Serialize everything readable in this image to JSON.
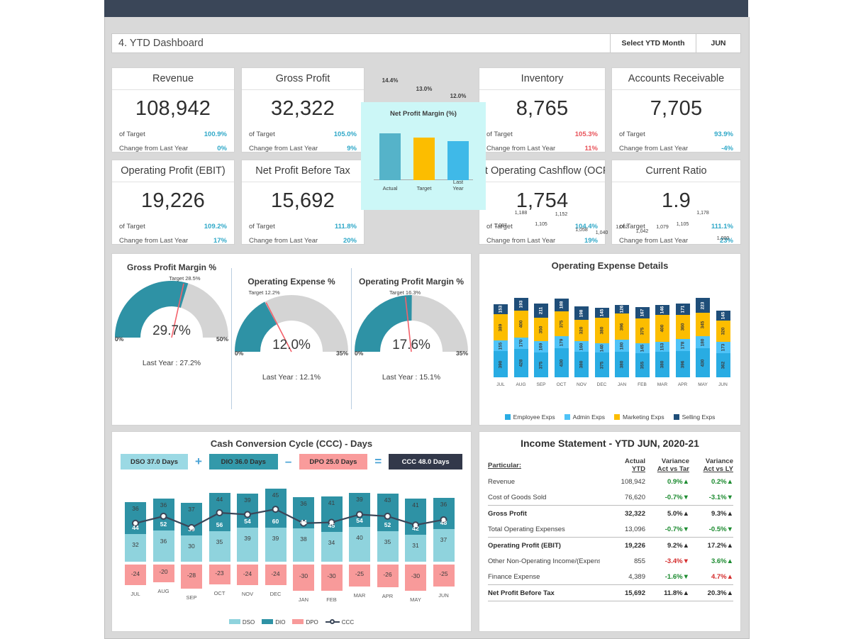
{
  "header": {
    "title": "4. YTD Dashboard",
    "select_label": "Select YTD Month",
    "select_value": "JUN"
  },
  "kpis": [
    {
      "title": "Revenue",
      "value": "108,942",
      "target_label": "of Target",
      "target_value": "100.9%",
      "target_tone": "pos",
      "ly_label": "Change from Last Year",
      "ly_value": "0%",
      "ly_tone": "pos"
    },
    {
      "title": "Gross Profit",
      "value": "32,322",
      "target_label": "of Target",
      "target_value": "105.0%",
      "target_tone": "pos",
      "ly_label": "Change from Last Year",
      "ly_value": "9%",
      "ly_tone": "pos"
    },
    {
      "title": "Inventory",
      "value": "8,765",
      "target_label": "of Target",
      "target_value": "105.3%",
      "target_tone": "neg",
      "ly_label": "Change from Last Year",
      "ly_value": "11%",
      "ly_tone": "neg"
    },
    {
      "title": "Accounts Receivable",
      "value": "7,705",
      "target_label": "of Target",
      "target_value": "93.9%",
      "target_tone": "pos",
      "ly_label": "Change from Last Year",
      "ly_value": "-4%",
      "ly_tone": "pos"
    },
    {
      "title": "Operating Profit (EBIT)",
      "value": "19,226",
      "target_label": "of Target",
      "target_value": "109.2%",
      "target_tone": "pos",
      "ly_label": "Change from Last Year",
      "ly_value": "17%",
      "ly_tone": "pos"
    },
    {
      "title": "Net Profit Before Tax",
      "value": "15,692",
      "target_label": "of Target",
      "target_value": "111.8%",
      "target_tone": "pos",
      "ly_label": "Change from Last Year",
      "ly_value": "20%",
      "ly_tone": "pos"
    },
    {
      "title": "Net Operating Cashflow (OCF)",
      "value": "1,754",
      "target_label": "of Target",
      "target_value": "104.4%",
      "target_tone": "pos",
      "ly_label": "Change from Last Year",
      "ly_value": "19%",
      "ly_tone": "pos"
    },
    {
      "title": "Current Ratio",
      "value": "1.9",
      "target_label": "of Target",
      "target_value": "111.1%",
      "target_tone": "pos",
      "ly_label": "Change from Last Year",
      "ly_value": "23%",
      "ly_tone": "pos"
    }
  ],
  "gauges_panel_title": "",
  "gauges": [
    {
      "title": "Gross Profit Margin %",
      "value": "29.7%",
      "value_num": 29.7,
      "min": "0%",
      "max": "50%",
      "min_num": 0,
      "max_num": 50,
      "target_label": "Target 28.5%",
      "target_num": 28.5,
      "last_year": "Last Year : 27.2%"
    },
    {
      "title": "Operating Expense %",
      "value": "12.0%",
      "value_num": 12.0,
      "min": "0%",
      "max": "35%",
      "min_num": 0,
      "max_num": 35,
      "target_label": "Target 12.2%",
      "target_num": 12.2,
      "last_year": "Last Year : 12.1%"
    },
    {
      "title": "Operating Profit Margin %",
      "value": "17.6%",
      "value_num": 17.6,
      "min": "0%",
      "max": "35%",
      "min_num": 0,
      "max_num": 35,
      "target_label": "Target 16.3%",
      "target_num": 16.3,
      "last_year": "Last Year : 15.1%"
    }
  ],
  "income_statement": {
    "title": "Income Statement - YTD JUN, 2020-21",
    "columns": [
      "Particular:",
      "Actual\nYTD",
      "Variance\nAct vs Tar",
      "Variance\nAct vs LY"
    ],
    "col_particulars": "Particular:",
    "col_actual_1": "Actual",
    "col_actual_2": "YTD",
    "col_var_tar_1": "Variance",
    "col_var_tar_2": "Act vs Tar",
    "col_var_ly_1": "Variance",
    "col_var_ly_2": "Act vs LY",
    "rows": [
      {
        "label": "Revenue",
        "actual": "108,942",
        "var_tar": "0.9%▲",
        "var_tar_tone": "up",
        "var_ly": "0.2%▲",
        "var_ly_tone": "up",
        "bold": false
      },
      {
        "label": "Cost of Goods Sold",
        "actual": "76,620",
        "var_tar": "-0.7%▼",
        "var_tar_tone": "up",
        "var_ly": "-3.1%▼",
        "var_ly_tone": "up",
        "bold": false
      },
      {
        "label": "Gross Profit",
        "actual": "32,322",
        "var_tar": "5.0%▲",
        "var_tar_tone": "up",
        "var_ly": "9.3%▲",
        "var_ly_tone": "up",
        "bold": true
      },
      {
        "label": "Total Operating Expenses",
        "actual": "13,096",
        "var_tar": "-0.7%▼",
        "var_tar_tone": "up",
        "var_ly": "-0.5%▼",
        "var_ly_tone": "up",
        "bold": false
      },
      {
        "label": "Operating Profit (EBIT)",
        "actual": "19,226",
        "var_tar": "9.2%▲",
        "var_tar_tone": "up",
        "var_ly": "17.2%▲",
        "var_ly_tone": "up",
        "bold": true
      },
      {
        "label": "Other Non-Operating Income/(Expens",
        "actual": "855",
        "var_tar": "-3.4%▼",
        "var_tar_tone": "bad",
        "var_ly": "3.6%▲",
        "var_ly_tone": "up",
        "bold": false
      },
      {
        "label": "Finance Expense",
        "actual": "4,389",
        "var_tar": "-1.6%▼",
        "var_tar_tone": "up",
        "var_ly": "4.7%▲",
        "var_ly_tone": "bad",
        "bold": false
      },
      {
        "label": "Net Profit Before Tax",
        "actual": "15,692",
        "var_tar": "11.8%▲",
        "var_tar_tone": "up",
        "var_ly": "20.3%▲",
        "var_ly_tone": "up",
        "bold": true
      }
    ]
  },
  "ccc": {
    "title": "Cash Conversion Cycle (CCC) - Days",
    "chips": [
      {
        "text": "DSO 37.0 Days",
        "bg": "#9bd9e4"
      },
      {
        "text": "DIO 36.0 Days",
        "bg": "#3399aa"
      },
      {
        "text": "DPO 25.0 Days",
        "bg": "#f99b9b"
      },
      {
        "text": "CCC 48.0 Days",
        "bg": "#32384a"
      }
    ],
    "ops": [
      "+",
      "–",
      "="
    ],
    "legend": [
      "DSO",
      "DIO",
      "DPO",
      "CCC"
    ]
  },
  "colors": {
    "teal": "#3e9fb5",
    "dark_blue": "#1f5f9e",
    "light_blue": "#29ace3",
    "amber": "#fcbd00",
    "navy": "#1f4e79",
    "dso": "#8fd3dd",
    "dio": "#2e92a5",
    "dpo": "#f89a9a",
    "ccc_line": "#3a4658",
    "topbar": "#3a4658",
    "npm_bg": "#ccf7f7"
  },
  "chart_data": [
    {
      "type": "bar",
      "title": "Net Profit Margin (%)",
      "categories": [
        "Actual",
        "Target",
        "Last Year"
      ],
      "values": [
        14.4,
        13.0,
        12.0
      ],
      "labels": [
        "14.4%",
        "13.0%",
        "12.0%"
      ],
      "colors": [
        "#55b3c9",
        "#fcbd00",
        "#3fb9e8"
      ],
      "ylim": [
        0,
        17
      ],
      "grid": false,
      "legend": "none"
    },
    {
      "type": "bar",
      "title": "Operating Expense Details",
      "stacked": true,
      "categories": [
        "JUL",
        "AUG",
        "SEP",
        "OCT",
        "NOV",
        "DEC",
        "JAN",
        "FEB",
        "MAR",
        "APR",
        "MAY",
        "JUN"
      ],
      "totals": [
        1087,
        1188,
        1105,
        1152,
        1058,
        1040,
        1062,
        1042,
        1079,
        1105,
        1178,
        1000
      ],
      "total_labels": [
        "1,087",
        "1,188",
        "1,105",
        "1,152",
        "1,058",
        "1,040",
        "1,062",
        "1,042",
        "1,079",
        "1,105",
        "1,178",
        "1,000"
      ],
      "series": [
        {
          "name": "Employee Exps",
          "color": "#29ace3",
          "values": [
            390,
            428,
            375,
            430,
            380,
            375,
            380,
            355,
            380,
            396,
            430,
            362
          ]
        },
        {
          "name": "Admin Exps",
          "color": "#4fc3f7",
          "values": [
            155,
            170,
            169,
            179,
            160,
            140,
            180,
            145,
            153,
            178,
            180,
            173
          ]
        },
        {
          "name": "Marketing Exps",
          "color": "#fcbd00",
          "values": [
            389,
            400,
            350,
            375,
            320,
            380,
            396,
            375,
            400,
            360,
            345,
            320
          ]
        },
        {
          "name": "Selling Exps",
          "color": "#1f4e79",
          "values": [
            153,
            193,
            211,
            188,
            198,
            145,
            126,
            167,
            146,
            171,
            223,
            145
          ]
        }
      ],
      "legend": "bottom",
      "ylim": [
        0,
        1250
      ]
    },
    {
      "type": "bar",
      "title": "Cash Conversion Cycle (CCC) - Days",
      "stacked": true,
      "categories": [
        "JUL",
        "AUG",
        "SEP",
        "OCT",
        "NOV",
        "DEC",
        "JAN",
        "FEB",
        "MAR",
        "APR",
        "MAY",
        "JUN"
      ],
      "series": [
        {
          "name": "DSO",
          "color": "#8fd3dd",
          "values": [
            32,
            36,
            30,
            35,
            39,
            39,
            38,
            34,
            40,
            35,
            31,
            37
          ]
        },
        {
          "name": "DIO",
          "color": "#2e92a5",
          "values": [
            36,
            36,
            37,
            44,
            39,
            45,
            36,
            41,
            39,
            43,
            41,
            36
          ]
        },
        {
          "name": "DPO",
          "color": "#f89a9a",
          "values": [
            -24,
            -20,
            -28,
            -23,
            -24,
            -24,
            -30,
            -30,
            -25,
            -26,
            -30,
            -25
          ]
        }
      ],
      "line": {
        "name": "CCC",
        "color": "#3a4658",
        "values": [
          44,
          52,
          39,
          56,
          54,
          60,
          44,
          45,
          54,
          52,
          42,
          48
        ]
      },
      "legend": "bottom",
      "ylim": [
        -35,
        95
      ]
    },
    {
      "type": "gauge",
      "title": "Gross Profit Margin %",
      "value": 29.7,
      "target": 28.5,
      "min": 0,
      "max": 50,
      "last_year": 27.2
    },
    {
      "type": "gauge",
      "title": "Operating Expense %",
      "value": 12.0,
      "target": 12.2,
      "min": 0,
      "max": 35,
      "last_year": 12.1
    },
    {
      "type": "gauge",
      "title": "Operating Profit Margin %",
      "value": 17.6,
      "target": 16.3,
      "min": 0,
      "max": 35,
      "last_year": 15.1
    }
  ]
}
